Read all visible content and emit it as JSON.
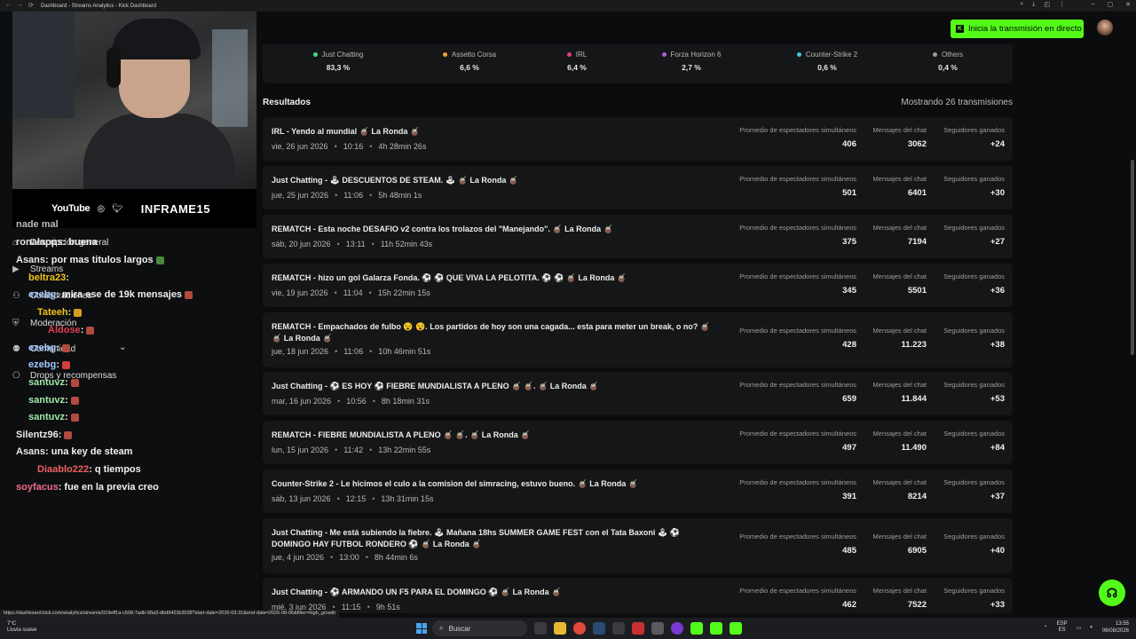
{
  "browser": {
    "tab_title": "Dashboard - Streams Analytics - Kick Dashboard",
    "status_url": "https://dashboard.kick.com/analytics/streams/019eff1a-c508-7adb-96a3-dbd9423b3038?start-date=2026-03-31&end-date=2026-08-06&filter=high_growth"
  },
  "header": {
    "live_button_label": "Inicia la transmisión en directo"
  },
  "overlay": {
    "social": {
      "youtube": "YouTube",
      "handle": "INFRAME15"
    }
  },
  "sidebar_menu": [
    {
      "label": "Descripción general",
      "icon": "home-icon"
    },
    {
      "label": "Streams",
      "icon": "video-icon"
    },
    {
      "label": "Colaboraciones",
      "icon": "handshake-icon"
    },
    {
      "label": "Moderación",
      "icon": "shield-icon"
    },
    {
      "label": "Comunidad",
      "icon": "people-icon"
    },
    {
      "label": "Drops y recompensas",
      "icon": "gift-icon"
    }
  ],
  "chat": [
    {
      "user": "nade mal",
      "msg": ""
    },
    {
      "user": "ronalapps",
      "msg": ": buena"
    },
    {
      "user": "Asans",
      "msg": ": por mas titulos largos"
    },
    {
      "user": "beltra23",
      "msg": ":"
    },
    {
      "user": "ezebg",
      "msg": ": mira ese de 19k mensajes"
    },
    {
      "user": "Tateeh",
      "msg": ":"
    },
    {
      "user": "Aldose",
      "msg": ":"
    },
    {
      "user": "ezebg",
      "msg": ":"
    },
    {
      "user": "ezebg",
      "msg": ":"
    },
    {
      "user": "santuvz",
      "msg": ":"
    },
    {
      "user": "santuvz",
      "msg": ":"
    },
    {
      "user": "santuvz",
      "msg": ":"
    },
    {
      "user": "Silentz96",
      "msg": ":"
    },
    {
      "user": "Asans",
      "msg": ": una key de steam"
    },
    {
      "user": "Diaablo222",
      "msg": ": q tiempos"
    },
    {
      "user": "soyfacus",
      "msg": ": fue en la previa creo"
    }
  ],
  "categories": [
    {
      "name": "Just Chatting",
      "pct": "83,3 %",
      "color": "#3ddc84"
    },
    {
      "name": "Assetto Corsa",
      "pct": "6,6 %",
      "color": "#f0a030"
    },
    {
      "name": "IRL",
      "pct": "6,4 %",
      "color": "#e0407a"
    },
    {
      "name": "Forza Horizon 6",
      "pct": "2,7 %",
      "color": "#b05ae0"
    },
    {
      "name": "Counter-Strike 2",
      "pct": "0,6 %",
      "color": "#40c8e0"
    },
    {
      "name": "Others",
      "pct": "0,4 %",
      "color": "#9a9a9a"
    }
  ],
  "results": {
    "title": "Resultados",
    "count_label": "Mostrando 26 transmisiones",
    "stat_labels": {
      "viewers": "Promedio de espectadores simultáneos",
      "chat": "Mensajes del chat",
      "followers": "Seguidores ganados"
    },
    "rows": [
      {
        "title": "IRL - Yendo al mundial 🧉 La Ronda 🧉",
        "date": "vie, 26 jun 2026",
        "time": "10:16",
        "duration": "4h 28min 26s",
        "viewers": "406",
        "chat": "3062",
        "followers": "+24"
      },
      {
        "title": "Just Chatting - 🕹 DESCUENTOS DE STEAM. 🕹 🧉 La Ronda 🧉",
        "date": "jue, 25 jun 2026",
        "time": "11:06",
        "duration": "5h 48min 1s",
        "viewers": "501",
        "chat": "6401",
        "followers": "+30"
      },
      {
        "title": "REMATCH - Esta noche DESAFIO v2 contra los trolazos del \"Manejando\". 🧉 La Ronda 🧉",
        "date": "sáb, 20 jun 2026",
        "time": "13:11",
        "duration": "11h 52min 43s",
        "viewers": "375",
        "chat": "7194",
        "followers": "+27"
      },
      {
        "title": "REMATCH - hizo un gol Galarza Fonda. ⚽ ⚽ QUE VIVA LA PELOTITA. ⚽ ⚽ 🧉 La Ronda 🧉",
        "date": "vie, 19 jun 2026",
        "time": "11:04",
        "duration": "15h 22min 15s",
        "viewers": "345",
        "chat": "5501",
        "followers": "+36"
      },
      {
        "title": "REMATCH - Empachados de fulbo 😵 😵. Los partidos de hoy son una cagada... esta para meter un break, o no? 🧉 🧉 La Ronda 🧉",
        "date": "jue, 18 jun 2026",
        "time": "11:06",
        "duration": "10h 46min 51s",
        "viewers": "428",
        "chat": "11.223",
        "followers": "+38"
      },
      {
        "title": "Just Chatting - ⚽ ES HOY ⚽ FIEBRE MUNDIALISTA A PLENO 🧉 🧉. 🧉 La Ronda 🧉",
        "date": "mar, 16 jun 2026",
        "time": "10:56",
        "duration": "8h 18min 31s",
        "viewers": "659",
        "chat": "11.844",
        "followers": "+53"
      },
      {
        "title": "REMATCH - FIEBRE MUNDIALISTA A PLENO 🧉 🧉. 🧉 La Ronda 🧉",
        "date": "lun, 15 jun 2026",
        "time": "11:42",
        "duration": "13h 22min 55s",
        "viewers": "497",
        "chat": "11.490",
        "followers": "+84"
      },
      {
        "title": "Counter-Strike 2 - Le hicimos el culo a la comision del simracing, estuvo bueno. 🧉 La Ronda 🧉",
        "date": "sáb, 13 jun 2026",
        "time": "12:15",
        "duration": "13h 31min 15s",
        "viewers": "391",
        "chat": "8214",
        "followers": "+37"
      },
      {
        "title": "Just Chatting - Me está subiendo la fiebre. 🕹 Mañana 18hs SUMMER GAME FEST con el Tata Baxoni 🕹 ⚽ DOMINGO HAY FUTBOL RONDERO ⚽ 🧉 La Ronda 🧉",
        "date": "jue, 4 jun 2026",
        "time": "13:00",
        "duration": "8h 44min 6s",
        "viewers": "485",
        "chat": "6905",
        "followers": "+40"
      },
      {
        "title": "Just Chatting - ⚽ ARMANDO UN F5 PARA EL DOMINGO ⚽ 🧉 La Ronda 🧉",
        "date": "mié, 3 jun 2026",
        "time": "11:15",
        "duration": "9h 51s",
        "viewers": "462",
        "chat": "7522",
        "followers": "+33"
      }
    ]
  },
  "taskbar": {
    "weather_temp": "7°C",
    "weather_desc": "Lluvia suave",
    "search_label": "Buscar",
    "lang": "ESP",
    "lang2": "ES",
    "time": "13:55",
    "date": "06/08/2026"
  }
}
